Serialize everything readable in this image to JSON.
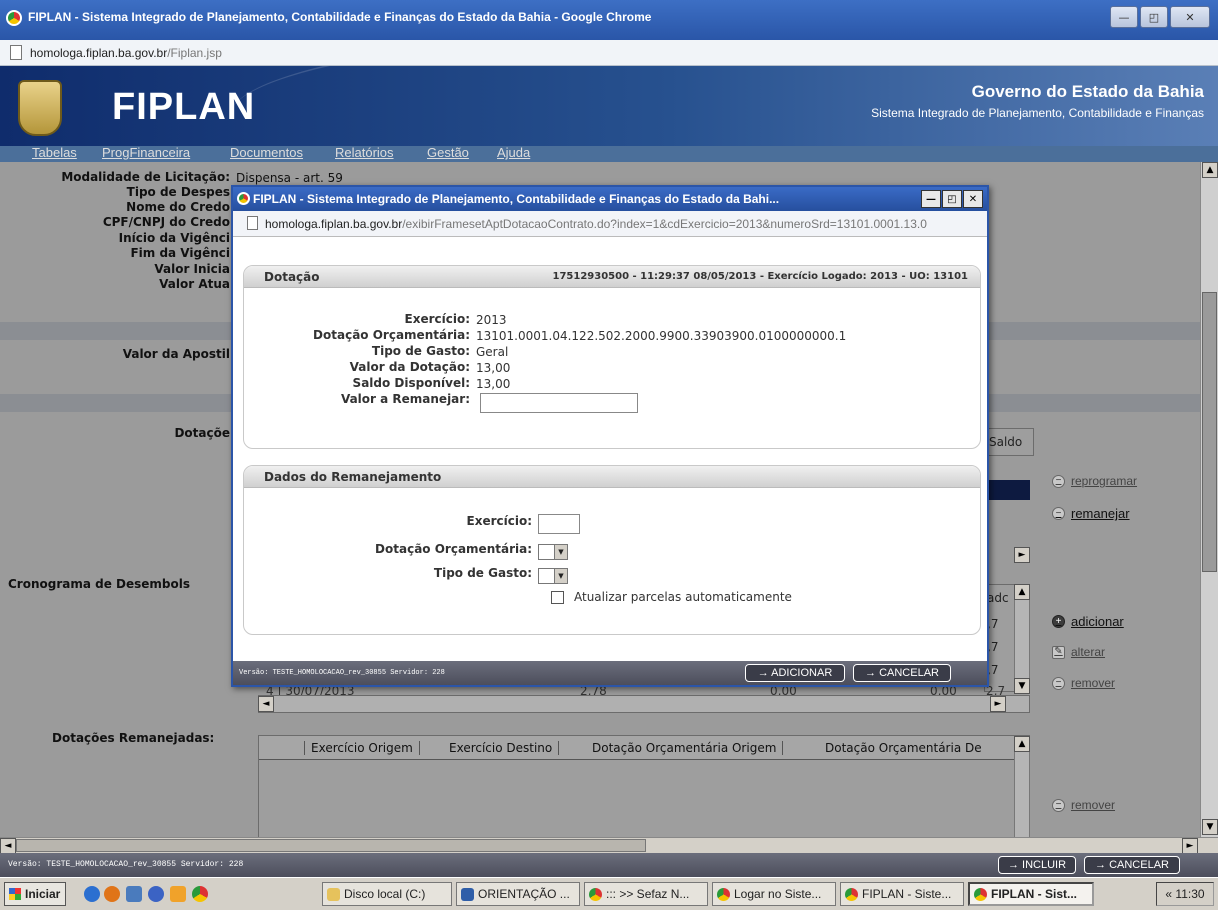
{
  "window": {
    "title": "FIPLAN - Sistema Integrado de Planejamento, Contabilidade e Finanças do Estado da Bahia - Google Chrome",
    "url_host": "homologa.fiplan.ba.gov.br",
    "url_path": "/Fiplan.jsp",
    "minimize": "—",
    "maximize": "◰",
    "close": "✕"
  },
  "header": {
    "brand": "FIPLAN",
    "gov_title": "Governo do Estado da Bahia",
    "gov_subtitle": "Sistema Integrado de Planejamento, Contabilidade e Finanças"
  },
  "menu": [
    "Tabelas",
    "ProgFinanceira",
    "Documentos",
    "Relatórios",
    "Gestão",
    "Ajuda"
  ],
  "background": {
    "labels": {
      "modalidade": "Modalidade de Licitação:",
      "modalidade_val": "Dispensa - art. 59",
      "tipo_despesa": "Tipo de Despes",
      "nome_credor": "Nome do Credo",
      "cpf_cnpj": "CPF/CNPJ do Credo",
      "inicio_vigencia": "Início da Vigênci",
      "fim_vigencia": "Fim da Vigênci",
      "valor_inicial": "Valor Inicia",
      "valor_atual": "Valor Atua",
      "valor_apostila": "Valor da Apostil",
      "dotacoes": "Dotaçõe",
      "cronograma": "Cronograma de Desembols",
      "dotacoes_remanejadas": "Dotações Remanejadas:"
    },
    "saldo_header": "Saldo",
    "crono_header": "adc",
    "crono_values": [
      ",7",
      ",7",
      ",7",
      "2,7"
    ],
    "crono_last_row": {
      "n": "4",
      "date": "30/07/2013",
      "v1": "2,78",
      "v2": "0,00",
      "v3": "0,00"
    },
    "actions": {
      "reprogramar": "reprogramar",
      "remanejar": "remanejar",
      "adicionar": "adicionar",
      "alterar": "alterar",
      "remover": "remover",
      "remover2": "remover"
    },
    "remanejadas_headers": [
      "Exercício Origem",
      "Exercício Destino",
      "Dotação Orçamentária Origem",
      "Dotação Orçamentária De"
    ]
  },
  "statusbar": {
    "version": "Versão: TESTE_HOMOLOCACAO_rev_30855 Servidor: 228",
    "incluir": "→ INCLUIR",
    "cancelar": "→ CANCELAR"
  },
  "taskbar": {
    "start": "Iniciar",
    "tasks": [
      "Disco local (C:)",
      "ORIENTAÇÃO ...",
      "::: >> Sefaz N...",
      "Logar no Siste...",
      "FIPLAN - Siste...",
      "FIPLAN - Sist..."
    ],
    "clock": "« 11:30"
  },
  "modal": {
    "title": "FIPLAN - Sistema Integrado de Planejamento, Contabilidade e Finanças do Estado da Bahi...",
    "url_host": "homologa.fiplan.ba.gov.br",
    "url_path": "/exibirFramesetAptDotacaoContrato.do?index=1&cdExercicio=2013&numeroSrd=13101.0001.13.0",
    "dotacao": {
      "title": "Dotação",
      "info": "17512930500 - 11:29:37 08/05/2013 - Exercício Logado: 2013 - UO: 13101",
      "exercicio_label": "Exercício:",
      "exercicio_value": "2013",
      "dotacao_label": "Dotação Orçamentária:",
      "dotacao_value": "13101.0001.04.122.502.2000.9900.33903900.0100000000.1",
      "tipo_label": "Tipo de Gasto:",
      "tipo_value": "Geral",
      "valor_label": "Valor da Dotação:",
      "valor_value": "13,00",
      "saldo_label": "Saldo Disponível:",
      "saldo_value": "13,00",
      "remanejar_label": "Valor a Remanejar:",
      "remanejar_value": ""
    },
    "remanejamento": {
      "title": "Dados do Remanejamento",
      "exercicio_label": "Exercício:",
      "dotacao_label": "Dotação Orçamentária:",
      "tipo_label": "Tipo de Gasto:",
      "atualizar_label": "Atualizar parcelas automaticamente"
    },
    "footer": {
      "version": "Versão: TESTE_HOMOLOCACAO_rev_30855 Servidor: 228",
      "adicionar": "→ ADICIONAR",
      "cancelar": "→ CANCELAR"
    }
  }
}
